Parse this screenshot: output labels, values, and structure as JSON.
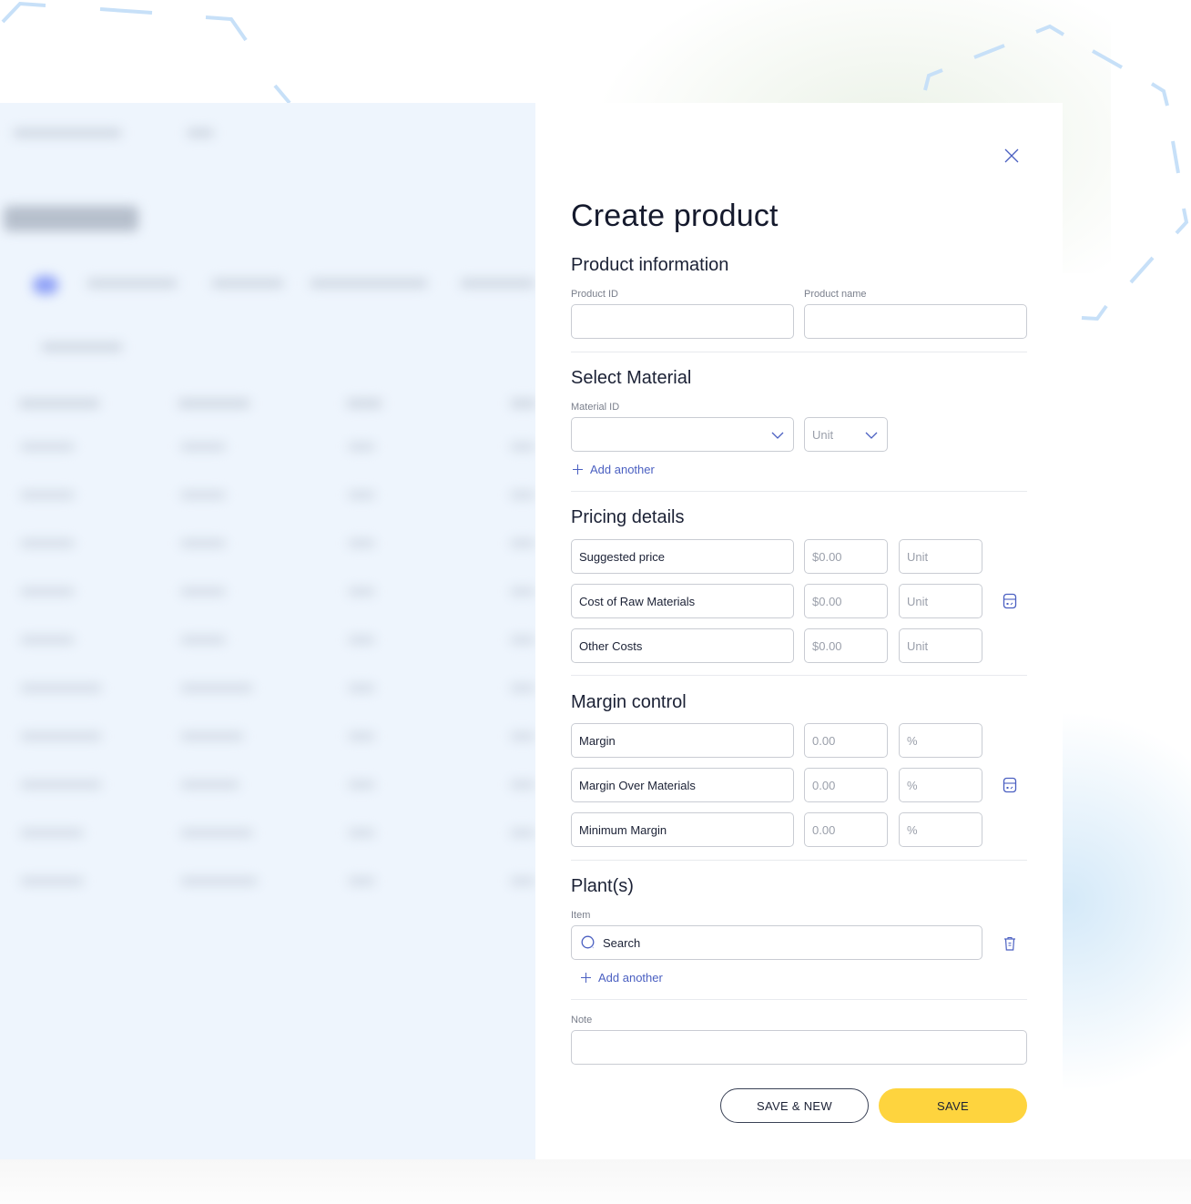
{
  "modal": {
    "title": "Create product",
    "close_icon": "close-icon",
    "product_information": {
      "heading": "Product information",
      "product_id": {
        "label": "Product ID",
        "value": ""
      },
      "product_name": {
        "label": "Product name",
        "value": ""
      }
    },
    "select_material": {
      "heading": "Select Material",
      "material_id": {
        "label": "Material ID",
        "value": ""
      },
      "unit_select": {
        "value": "Unit"
      },
      "add_another": "Add another"
    },
    "pricing_details": {
      "heading": "Pricing details",
      "rows": [
        {
          "label": "Suggested price",
          "amount": "$0.00",
          "unit": "Unit"
        },
        {
          "label": "Cost of Raw Materials",
          "amount": "$0.00",
          "unit": "Unit"
        },
        {
          "label": "Other Costs",
          "amount": "$0.00",
          "unit": "Unit"
        }
      ],
      "side_icon": "calculator-icon"
    },
    "margin_control": {
      "heading": "Margin control",
      "rows": [
        {
          "label": "Margin",
          "amount": "0.00",
          "unit": "%"
        },
        {
          "label": "Margin Over Materials",
          "amount": "0.00",
          "unit": "%"
        },
        {
          "label": "Minimum Margin",
          "amount": "0.00",
          "unit": "%"
        }
      ],
      "side_icon": "calculator-icon"
    },
    "plants": {
      "heading": "Plant(s)",
      "item": {
        "label": "Item",
        "placeholder": "Search"
      },
      "add_another": "Add another",
      "delete_icon": "trash-icon"
    },
    "note": {
      "label": "Note",
      "value": ""
    },
    "buttons": {
      "save_new": "SAVE & NEW",
      "save": "SAVE"
    }
  },
  "background": {
    "page_title": "Products",
    "state": "blurred"
  },
  "colors": {
    "accent": "#4a5fc1",
    "primary_button": "#fed43e",
    "title_text": "#151a2d",
    "border": "#c9ccd3",
    "background_blur": "#eef5fd"
  }
}
